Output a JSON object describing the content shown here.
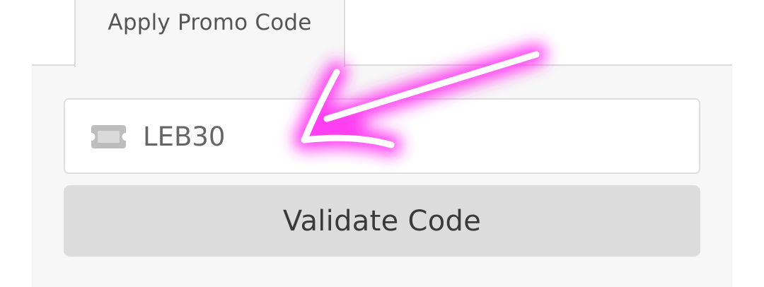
{
  "tab": {
    "label": "Apply Promo Code"
  },
  "promo": {
    "value": "LEB30",
    "icon": "ticket-icon"
  },
  "validate": {
    "label": "Validate Code"
  },
  "annotation": {
    "icon": "arrow-annotation",
    "glow_color": "#ff2cf0",
    "stroke_color": "#ffffff"
  }
}
